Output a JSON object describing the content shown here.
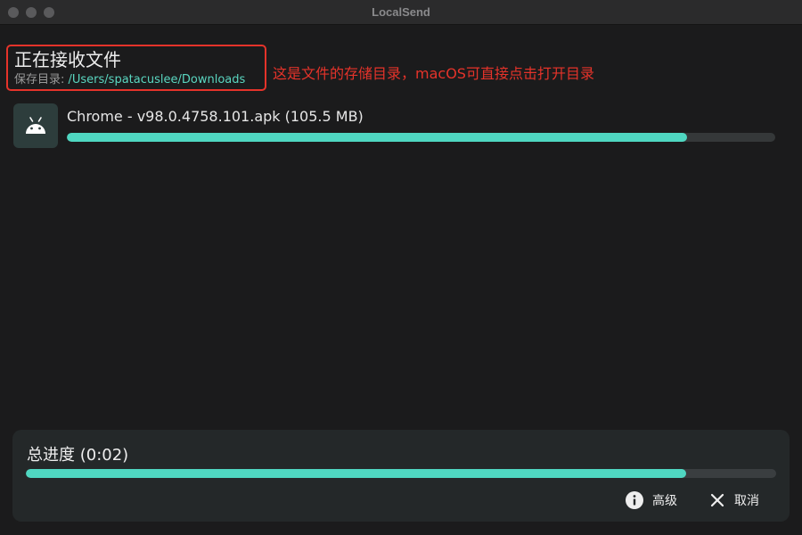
{
  "window": {
    "title": "LocalSend"
  },
  "header": {
    "title": "正在接收文件",
    "save_dir_label": "保存目录: ",
    "save_dir_path": "/Users/spatacuslee/Downloads"
  },
  "annotation": {
    "text": "这是文件的存储目录，macOS可直接点击打开目录",
    "color": "#e5332a"
  },
  "files": [
    {
      "icon": "android-icon",
      "name": "Chrome - v98.0.4758.101.apk (105.5 MB)",
      "progress": 0.876
    }
  ],
  "total": {
    "label": "总进度 (0:02)",
    "progress": 0.88
  },
  "actions": {
    "advanced_label": "高级",
    "advanced_icon": "info-icon",
    "cancel_label": "取消",
    "cancel_icon": "close-icon"
  },
  "colors": {
    "accent": "#4fd7c1",
    "background": "#1b1b1c"
  }
}
